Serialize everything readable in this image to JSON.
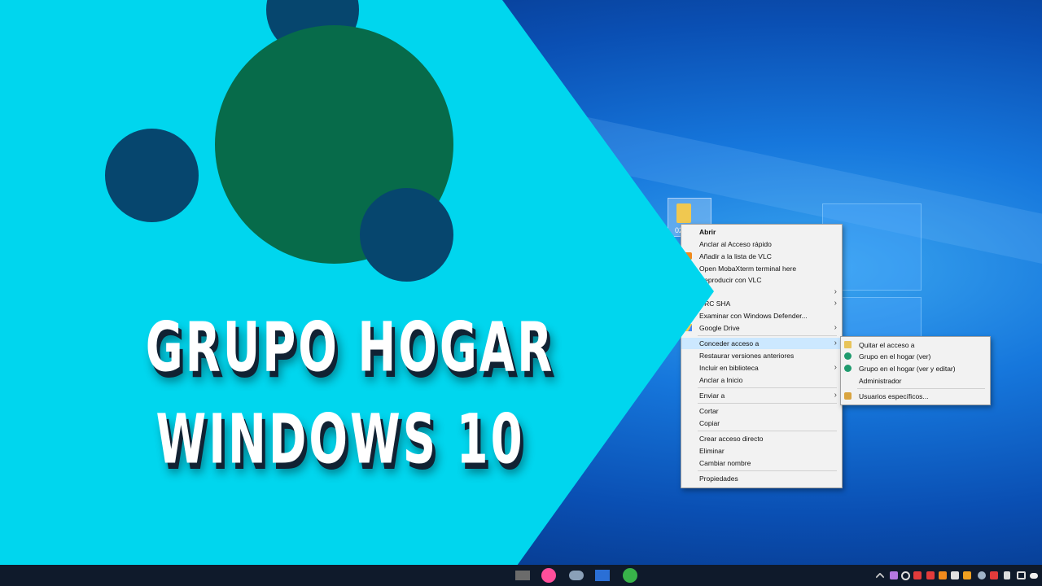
{
  "banner": {
    "title_line1": "GRUPO HOGAR",
    "title_line2": "WINDOWS 10"
  },
  "desktop": {
    "folder_label": "02"
  },
  "context_menu": {
    "items": [
      {
        "label": "Abrir",
        "bold": true
      },
      {
        "label": "Anclar al Acceso rápido"
      },
      {
        "label": "Añadir a la lista de VLC"
      },
      {
        "label": "Open MobaXterm terminal here"
      },
      {
        "label": "Reproducir con VLC"
      },
      {
        "label": "",
        "submenu": true
      },
      {
        "label": "CRC SHA",
        "submenu": true
      },
      {
        "label": "Examinar con Windows Defender..."
      },
      {
        "label": "Google Drive",
        "submenu": true
      },
      {
        "label": "Conceder acceso a",
        "submenu": true,
        "highlighted": true
      },
      {
        "label": "Restaurar versiones anteriores"
      },
      {
        "label": "Incluir en biblioteca",
        "submenu": true
      },
      {
        "label": "Anclar a Inicio"
      },
      {
        "label": "Enviar a",
        "submenu": true
      },
      {
        "label": "Cortar"
      },
      {
        "label": "Copiar"
      },
      {
        "label": "Crear acceso directo"
      },
      {
        "label": "Eliminar"
      },
      {
        "label": "Cambiar nombre"
      },
      {
        "label": "Propiedades"
      }
    ]
  },
  "submenu": {
    "items": [
      {
        "label": "Quitar el acceso a",
        "icon": "lock-icon"
      },
      {
        "label": "Grupo en el hogar (ver)",
        "icon": "homegroup-icon"
      },
      {
        "label": "Grupo en el hogar (ver y editar)",
        "icon": "homegroup-icon"
      },
      {
        "label": "Administrador"
      },
      {
        "label": "Usuarios específicos...",
        "icon": "users-icon"
      }
    ]
  },
  "colors": {
    "banner_cyan": "#00d6ee",
    "circle_green": "#076b4a",
    "circle_navy": "#06466e"
  }
}
